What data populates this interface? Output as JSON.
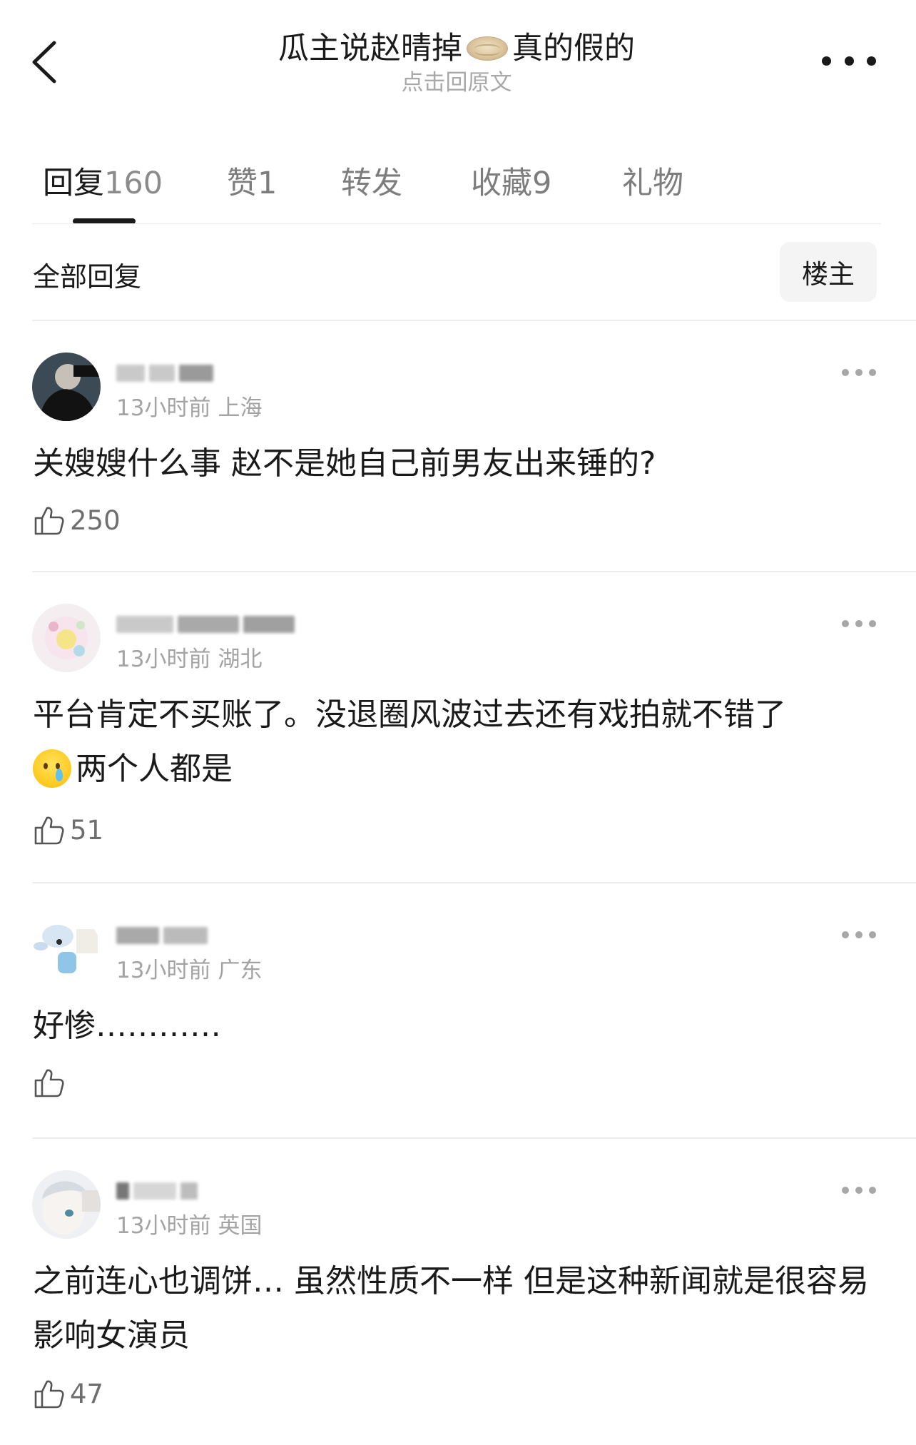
{
  "header": {
    "title_before": "瓜主说赵晴掉",
    "title_emoji": "pancake-emoji",
    "title_after": "真的假的",
    "subtitle": "点击回原文"
  },
  "tabs": [
    {
      "label": "回复",
      "count": "160",
      "active": true
    },
    {
      "label": "赞",
      "count": "1"
    },
    {
      "label": "转发",
      "count": ""
    },
    {
      "label": "收藏",
      "count": "9"
    },
    {
      "label": "礼物",
      "count": ""
    }
  ],
  "filter": {
    "label": "全部回复",
    "op_button": "楼主"
  },
  "comments": [
    {
      "time": "13小时前",
      "location": "上海",
      "text": "关嫂嫂什么事 赵不是她自己前男友出来锤的?",
      "likes": "250"
    },
    {
      "time": "13小时前",
      "location": "湖北",
      "text": "平台肯定不买账了。没退圈风波过去还有戏拍就不错了",
      "text2": "两个人都是",
      "emoji": "crying-face-emoji",
      "likes": "51"
    },
    {
      "time": "13小时前",
      "location": "广东",
      "text": "好惨…………",
      "likes": ""
    },
    {
      "time": "13小时前",
      "location": "英国",
      "text": "之前连心也调饼… 虽然性质不一样 但是这种新闻就是很容易影响女演员",
      "likes": "47"
    }
  ],
  "colors": {
    "text": "#1a1a1a",
    "muted": "#a3a3a3",
    "divider": "#ededed"
  }
}
